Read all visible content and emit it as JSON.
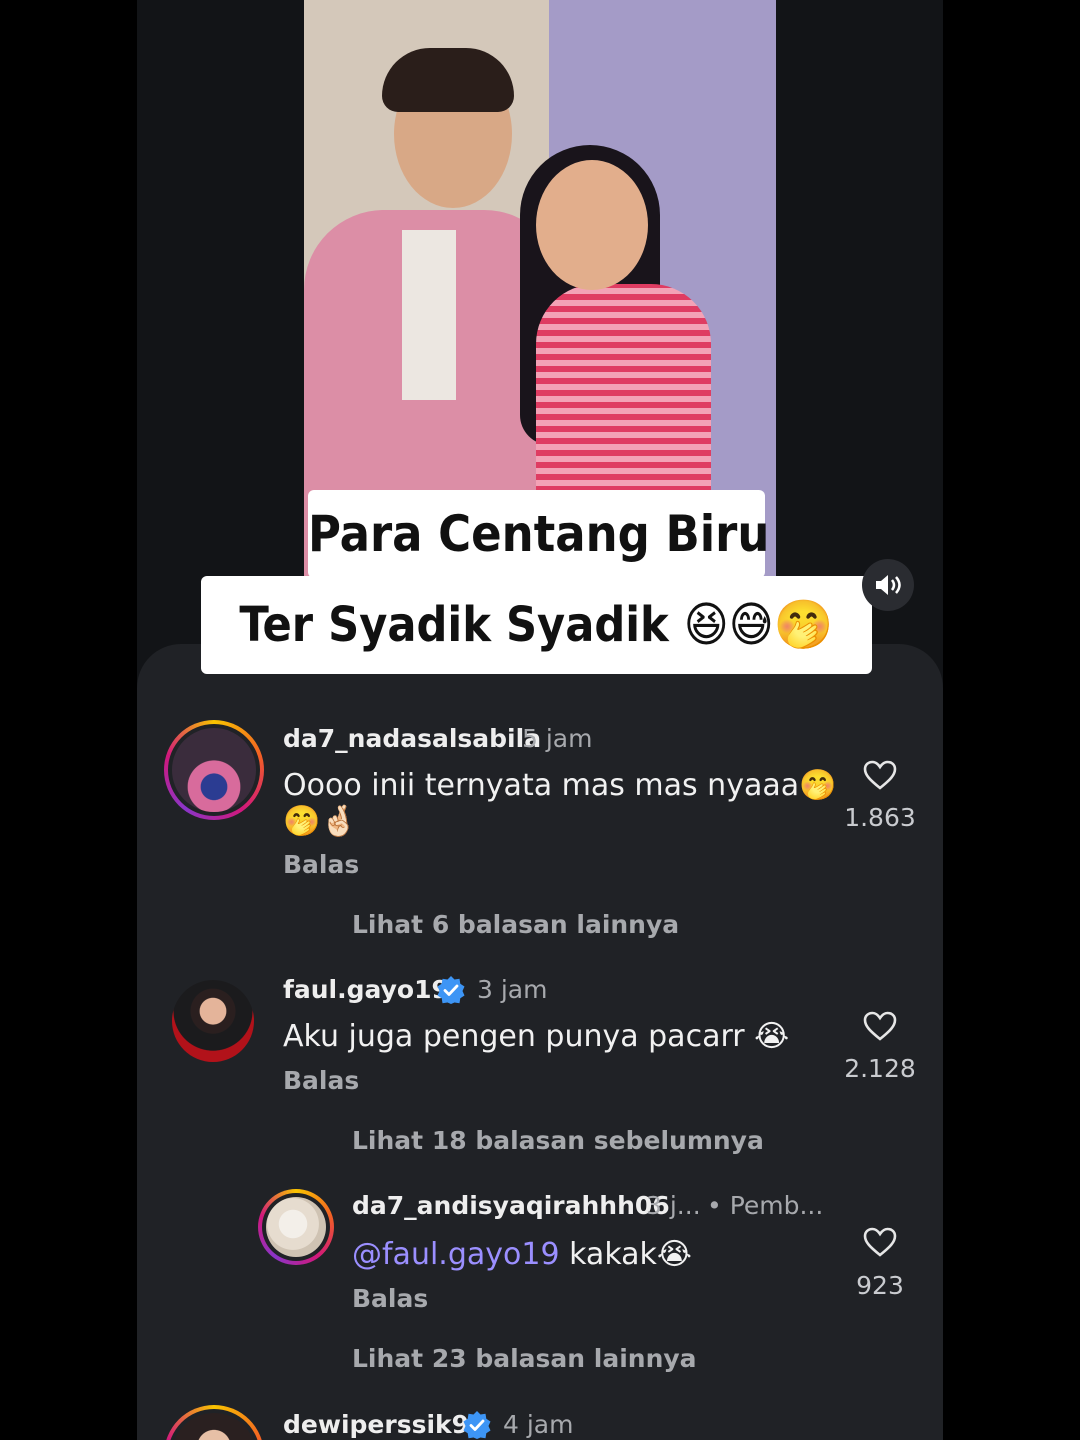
{
  "video": {
    "caption_line1": "Para Centang Biru",
    "caption_line2": "Ter Syadik Syadik 😆😅🤭"
  },
  "comments": [
    {
      "username": "da7_nadasalsabila",
      "time": "5 jam",
      "text_line1": "Oooo inii ternyata mas mas nyaaa🤭",
      "text_line2": "🤭🤞🏻",
      "reply": "Balas",
      "likes": "1.863",
      "more_replies": "Lihat 6 balasan lainnya"
    },
    {
      "username": "faul.gayo19",
      "time": "3 jam",
      "text": "Aku juga pengen punya pacarr 😭",
      "reply": "Balas",
      "likes": "2.128",
      "previous_replies": "Lihat 18 balasan sebelumnya",
      "replies": [
        {
          "username": "da7_andisyaqirahhh06",
          "time": "3 j...",
          "tag": "• Pemb...",
          "mention": "@faul.gayo19",
          "text": " kakak😭",
          "reply": "Balas",
          "likes": "923"
        }
      ],
      "more_replies": "Lihat 23 balasan lainnya"
    },
    {
      "username": "dewiperssik9",
      "time": "4 jam"
    }
  ],
  "colors": {
    "background": "#121417",
    "sheet": "#202226",
    "verified": "#3d95f5",
    "mention": "#9b8fff"
  }
}
